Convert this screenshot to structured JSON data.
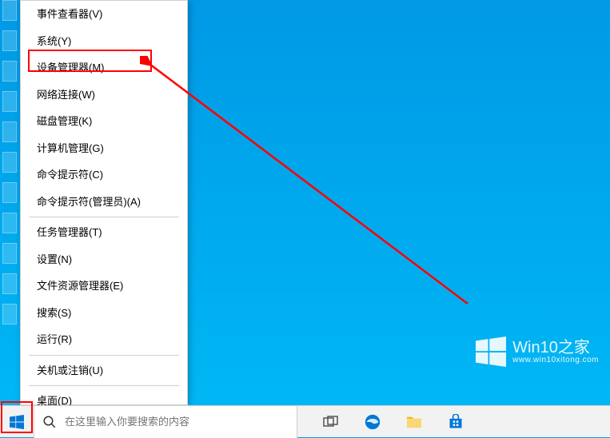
{
  "menu": {
    "items": [
      {
        "label": "事件查看器(V)"
      },
      {
        "label": "系统(Y)"
      },
      {
        "label": "设备管理器(M)"
      },
      {
        "label": "网络连接(W)"
      },
      {
        "label": "磁盘管理(K)"
      },
      {
        "label": "计算机管理(G)"
      },
      {
        "label": "命令提示符(C)"
      },
      {
        "label": "命令提示符(管理员)(A)"
      },
      {
        "label": "任务管理器(T)"
      },
      {
        "label": "设置(N)"
      },
      {
        "label": "文件资源管理器(E)"
      },
      {
        "label": "搜索(S)"
      },
      {
        "label": "运行(R)"
      },
      {
        "label": "关机或注销(U)"
      },
      {
        "label": "桌面(D)"
      }
    ]
  },
  "taskbar": {
    "search_placeholder": "在这里输入你要搜索的内容"
  },
  "watermark": {
    "title": "Win10之家",
    "url": "www.win10xitong.com"
  },
  "colors": {
    "desktop_bg": "#00a2e8",
    "highlight": "#ff0000",
    "win_blue": "#0078d7"
  }
}
